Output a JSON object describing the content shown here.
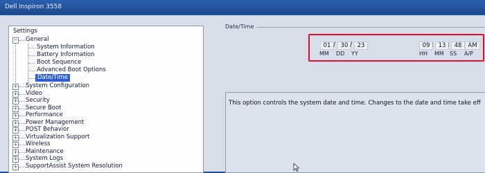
{
  "window": {
    "title": "Dell Inspiron 3558"
  },
  "tree": {
    "root": "Settings",
    "general": {
      "label": "General",
      "children": [
        "System Information",
        "Battery Information",
        "Boot Sequence",
        "Advanced Boot Options",
        "Date/Time"
      ],
      "selected": "Date/Time"
    },
    "groups": [
      "System Configuration",
      "Video",
      "Security",
      "Secure Boot",
      "Performance",
      "Power Management",
      "POST Behavior",
      "Virtualization Support",
      "Wireless",
      "Maintenance",
      "System Logs",
      "SupportAssist System Resolution"
    ]
  },
  "datetime": {
    "section_label": "Date/Time",
    "date": {
      "month": "01",
      "day": "30",
      "year": "23",
      "separator": "/"
    },
    "date_labels": [
      "MM",
      "DD",
      "YY"
    ],
    "time": {
      "hour": "09",
      "minute": "13",
      "second": "48",
      "ampm": "AM",
      "separator": ":"
    },
    "time_labels": [
      "HH",
      "MM",
      "SS",
      "A/P"
    ]
  },
  "description": "This option controls the system date and time. Changes to the date and time take eff",
  "colors": {
    "highlight": "#e0102a",
    "selection": "#2f5fcf"
  }
}
